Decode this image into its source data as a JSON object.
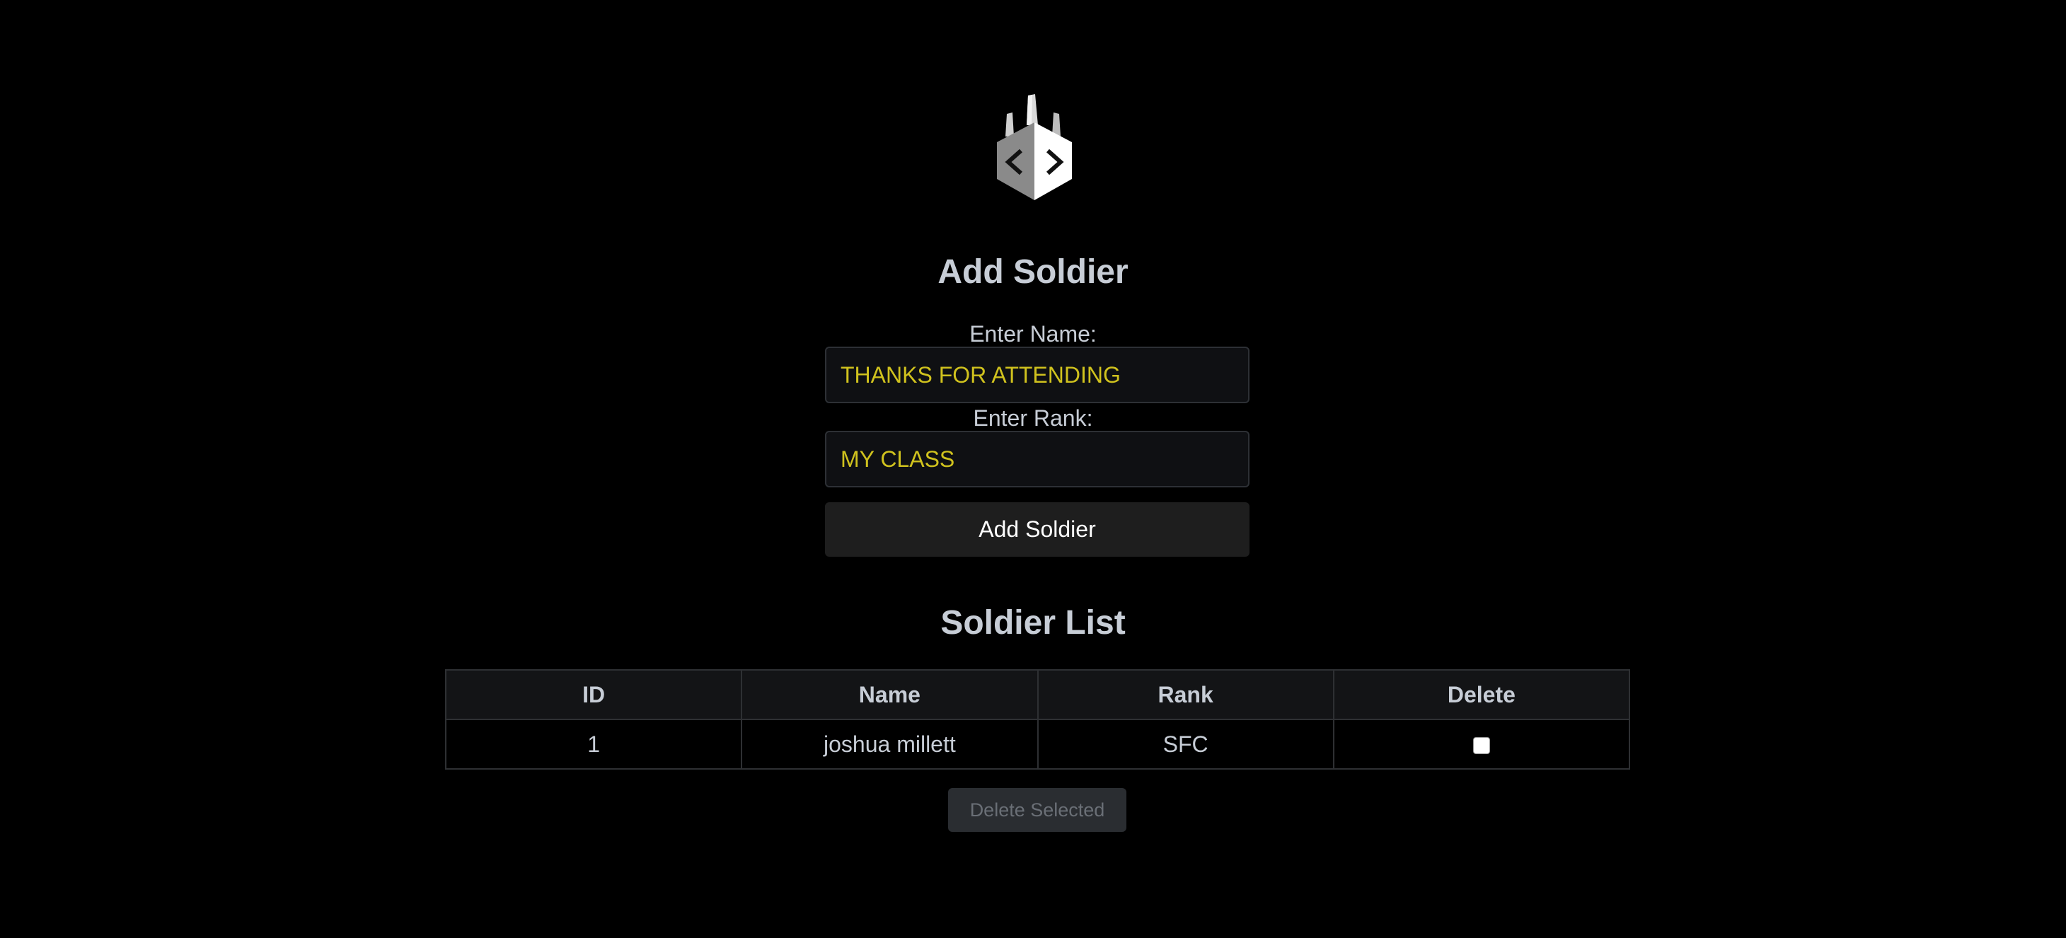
{
  "logo": {
    "icon": "code-brackets-logo-icon",
    "glyph": "< >"
  },
  "add_form": {
    "title": "Add Soldier",
    "name_label": "Enter Name:",
    "name_value": "THANKS FOR ATTENDING",
    "rank_label": "Enter Rank:",
    "rank_value": "MY CLASS",
    "submit_label": "Add Soldier"
  },
  "list": {
    "title": "Soldier List",
    "columns": [
      "ID",
      "Name",
      "Rank",
      "Delete"
    ],
    "rows": [
      {
        "id": "1",
        "name": "joshua millett",
        "rank": "SFC",
        "checked": false
      }
    ],
    "delete_label": "Delete Selected"
  },
  "colors": {
    "background": "#000000",
    "input_text": "#d0c21e",
    "heading": "#c7cdd6"
  }
}
